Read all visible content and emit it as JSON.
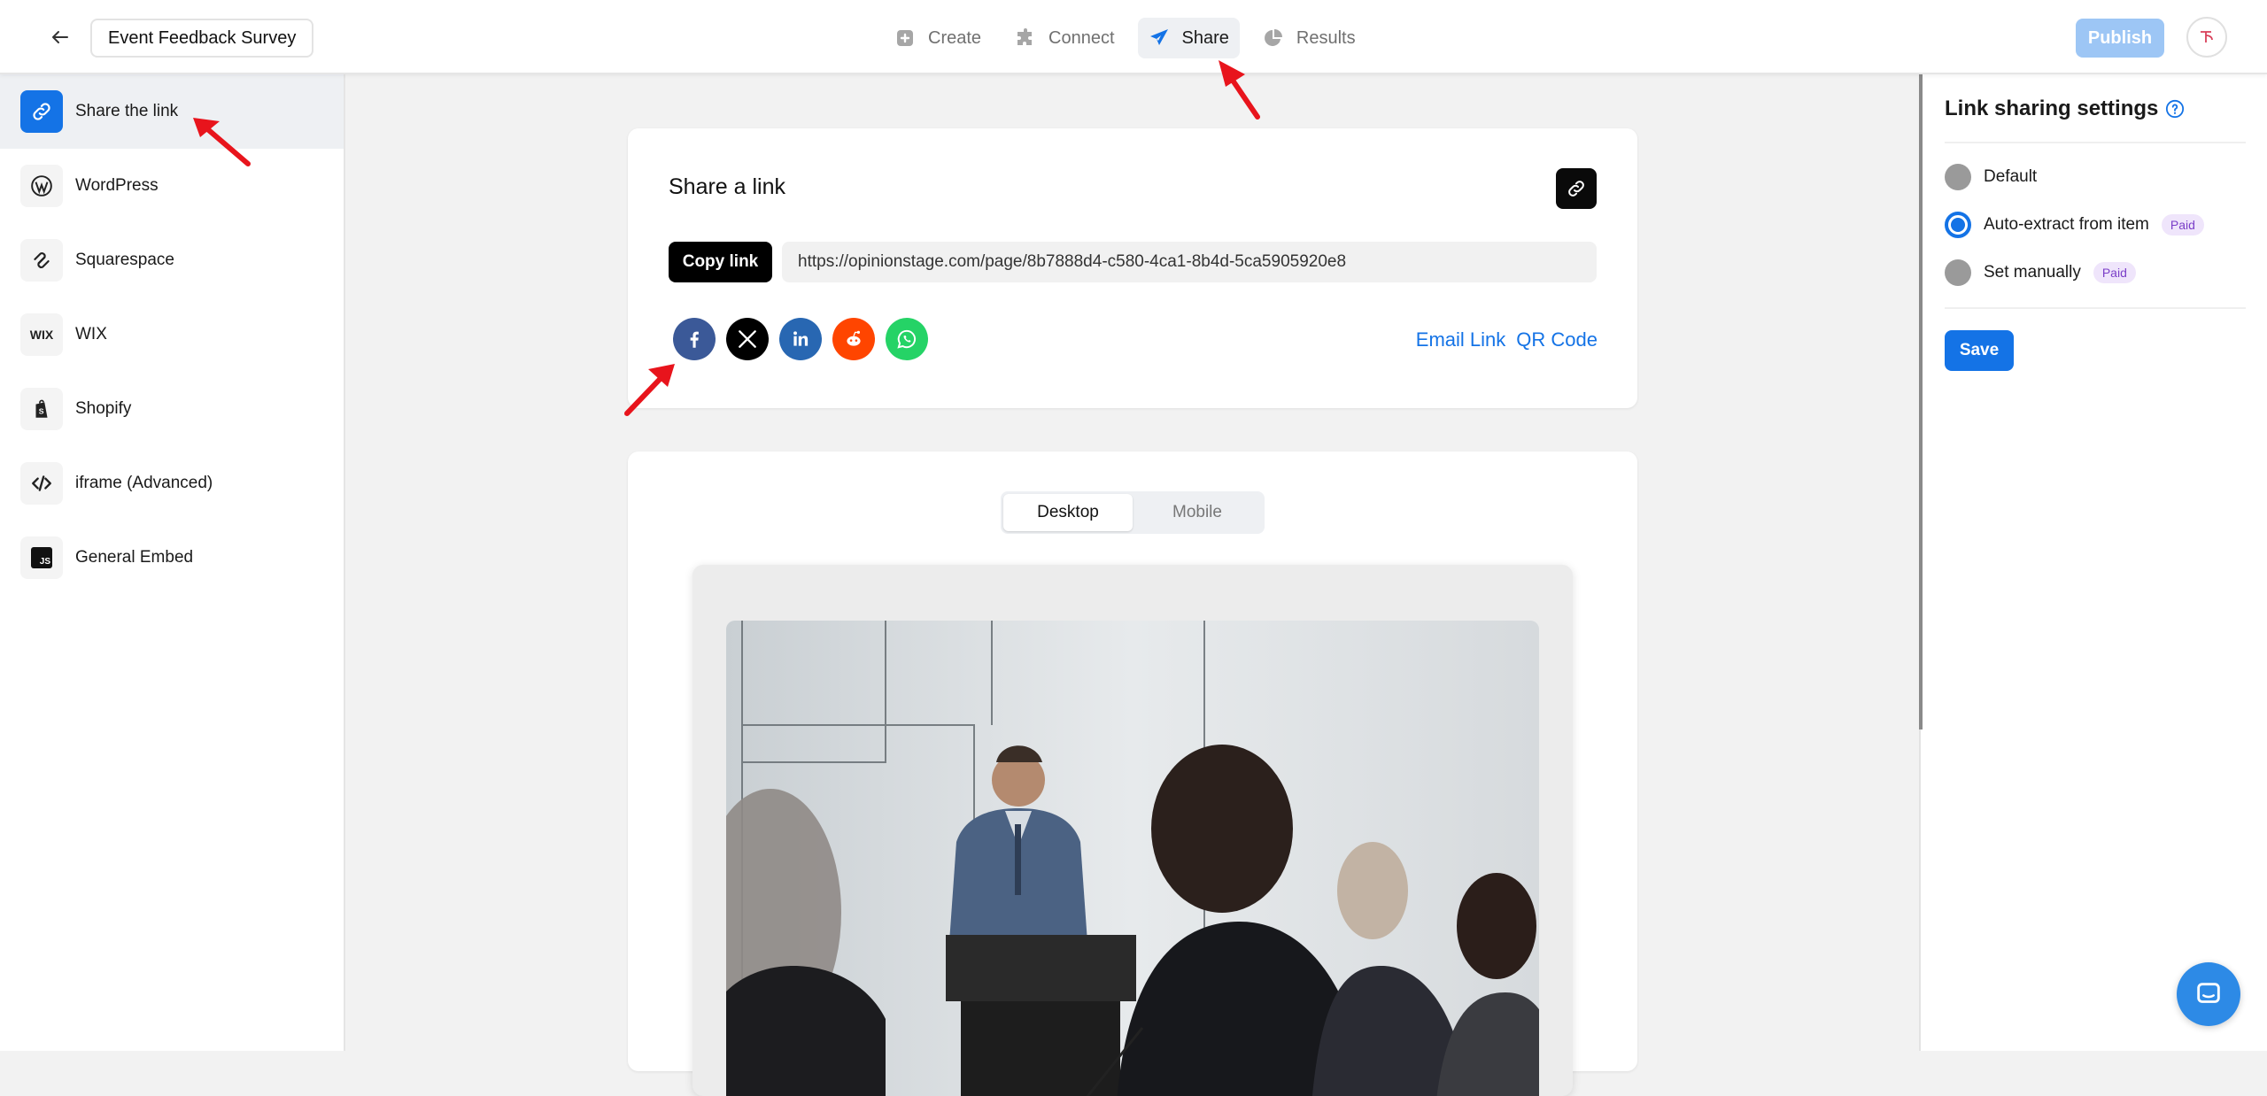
{
  "header": {
    "survey_title": "Event Feedback Survey",
    "nav": [
      {
        "label": "Create",
        "icon": "plus-square-icon"
      },
      {
        "label": "Connect",
        "icon": "puzzle-icon"
      },
      {
        "label": "Share",
        "icon": "paper-plane-icon",
        "active": true
      },
      {
        "label": "Results",
        "icon": "pie-chart-icon"
      }
    ],
    "publish_label": "Publish"
  },
  "sidebar": {
    "items": [
      {
        "label": "Share the link",
        "icon": "link-icon",
        "active": true
      },
      {
        "label": "WordPress",
        "icon": "wordpress-icon"
      },
      {
        "label": "Squarespace",
        "icon": "squarespace-icon"
      },
      {
        "label": "WIX",
        "icon": "wix-icon",
        "icon_text": "WIX"
      },
      {
        "label": "Shopify",
        "icon": "shopify-icon"
      },
      {
        "label": "iframe (Advanced)",
        "icon": "code-icon"
      },
      {
        "label": "General Embed",
        "icon": "js-icon",
        "icon_text": "JS"
      }
    ]
  },
  "share": {
    "title": "Share a link",
    "copy_label": "Copy link",
    "url": "https://opinionstage.com/page/8b7888d4-c580-4ca1-8b4d-5ca5905920e8",
    "socials": [
      "facebook",
      "x",
      "linkedin",
      "reddit",
      "whatsapp"
    ],
    "email_link_label": "Email Link",
    "qr_code_label": "QR Code"
  },
  "preview": {
    "tabs": [
      {
        "label": "Desktop",
        "active": true
      },
      {
        "label": "Mobile",
        "active": false
      }
    ]
  },
  "link_settings": {
    "title": "Link sharing settings",
    "options": [
      {
        "label": "Default",
        "selected": false,
        "paid": false
      },
      {
        "label": "Auto-extract from item",
        "selected": true,
        "paid": true
      },
      {
        "label": "Set manually",
        "selected": false,
        "paid": true
      }
    ],
    "paid_label": "Paid",
    "save_label": "Save"
  },
  "colors": {
    "accent": "#1473e6",
    "publish_disabled": "#9dc6f5",
    "facebook": "#3b5998",
    "linkedin": "#2867b2",
    "reddit": "#ff4500",
    "whatsapp": "#25d366",
    "annotation_arrow": "#e8141c"
  }
}
